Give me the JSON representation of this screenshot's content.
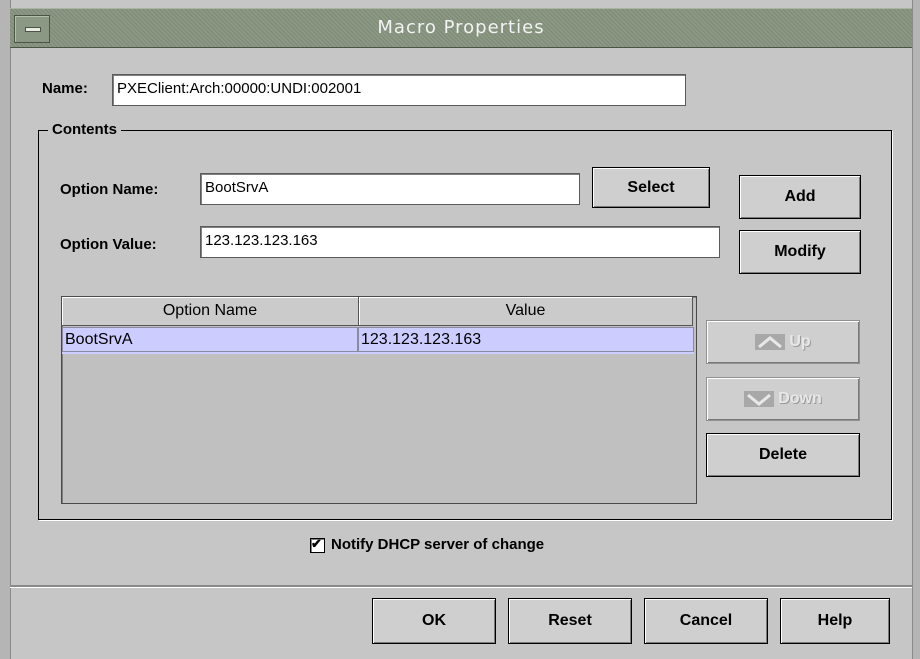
{
  "window": {
    "title": "Macro Properties"
  },
  "name_field": {
    "label": "Name:",
    "value": "PXEClient:Arch:00000:UNDI:002001"
  },
  "contents": {
    "group_label": "Contents",
    "option_name_label": "Option Name:",
    "option_name_value": "BootSrvA",
    "option_value_label": "Option Value:",
    "option_value_value": "123.123.123.163",
    "select_label": "Select",
    "add_label": "Add",
    "modify_label": "Modify",
    "up_label": "Up",
    "down_label": "Down",
    "delete_label": "Delete",
    "table": {
      "columns": [
        "Option Name",
        "Value"
      ],
      "rows": [
        {
          "option_name": "BootSrvA",
          "value": "123.123.123.163"
        }
      ]
    }
  },
  "notify": {
    "label": "Notify DHCP server of change",
    "checked": true
  },
  "footer": {
    "ok": "OK",
    "reset": "Reset",
    "cancel": "Cancel",
    "help": "Help"
  },
  "icons": {
    "window_menu": "window-menu-icon",
    "up": "up-arrow-icon",
    "down": "down-arrow-icon",
    "check": "check-icon"
  }
}
